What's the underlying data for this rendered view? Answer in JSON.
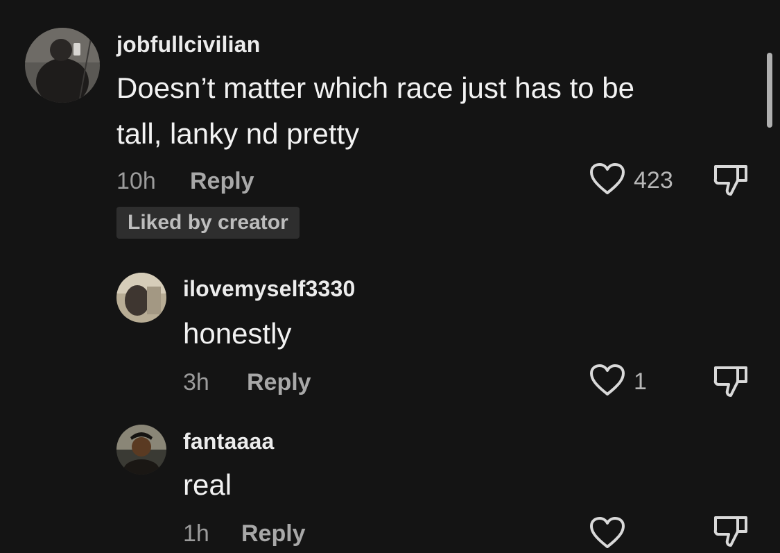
{
  "comments": [
    {
      "username": "jobfullcivilian",
      "text_lines": [
        "Doesn’t matter which race just has to be",
        "tall, lanky nd pretty"
      ],
      "time": "10h",
      "reply_label": "Reply",
      "like_count": "423",
      "badge": "Liked by creator"
    },
    {
      "username": "ilovemyself3330",
      "text_lines": [
        "honestly"
      ],
      "time": "3h",
      "reply_label": "Reply",
      "like_count": "1"
    },
    {
      "username": "fantaaaa",
      "text_lines": [
        "real"
      ],
      "time": "1h",
      "reply_label": "Reply",
      "like_count": ""
    }
  ],
  "icons": {
    "like": "heart-outline-icon",
    "dislike": "thumbs-down-outline-icon"
  },
  "colors": {
    "background": "#141414",
    "badge_background": "#2e2e2e"
  }
}
